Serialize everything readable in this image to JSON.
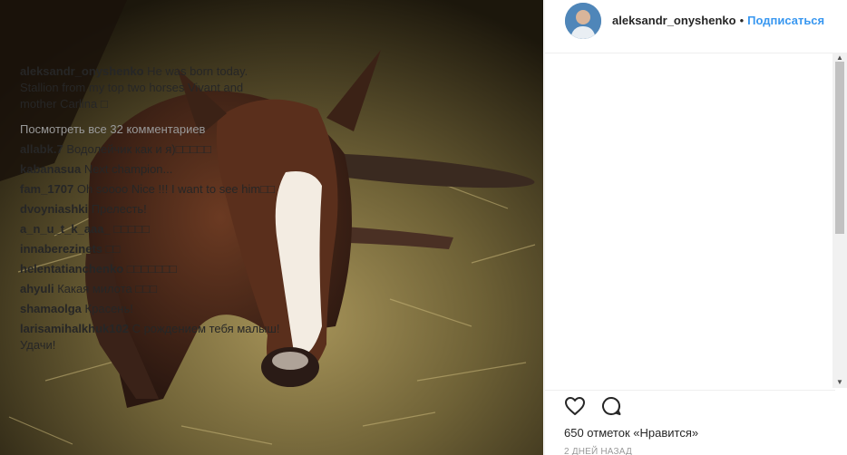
{
  "post": {
    "username": "aleksandr_onyshenko",
    "follow_label": "Подписаться",
    "separator": "•",
    "image_alt": "foal lying in straw"
  },
  "caption": {
    "username": "aleksandr_onyshenko",
    "text": " He was born today. Stallion from my top two horses Vivant and mother Carlina □"
  },
  "view_all_label": "Посмотреть все 32 комментариев",
  "comments": [
    {
      "user": "allabk.7",
      "text": " Водолейчик как и я)□□□□□"
    },
    {
      "user": "kabanasua",
      "text": " Next champion..."
    },
    {
      "user": "fam_1707",
      "text": " Oh soooo Nice !!! I want to see him□□"
    },
    {
      "user": "dvoyniashki",
      "text": " Прелесть!"
    },
    {
      "user": "a_n_u_t_k_aaa_",
      "text": " □□□□□"
    },
    {
      "user": "innaberezinets",
      "text": " □□"
    },
    {
      "user": "helentatianchenko",
      "text": " □□□□□□□"
    },
    {
      "user": "ahyuli",
      "text": " Какая милота □□□"
    },
    {
      "user": "shamaolga",
      "text": " Красень!"
    },
    {
      "user": "larisamihalkhuk102",
      "text": " С рождением тебя малыш!Удачи!"
    }
  ],
  "likes_label": "650 отметок «Нравится»",
  "time_label": "2 дней назад",
  "icons": {
    "like": "heart-icon",
    "comment": "comment-icon"
  },
  "colors": {
    "link": "#3897f0",
    "muted": "#999999",
    "text": "#262626"
  }
}
